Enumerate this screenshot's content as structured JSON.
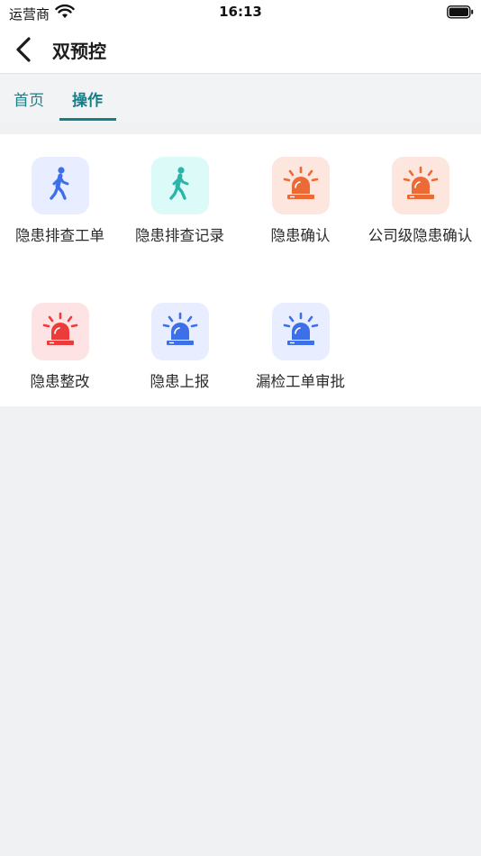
{
  "status_bar": {
    "carrier": "运营商",
    "time": "16:13"
  },
  "nav": {
    "title": "双预控"
  },
  "tabs": [
    {
      "label": "首页",
      "active": false
    },
    {
      "label": "操作",
      "active": true
    }
  ],
  "colors": {
    "accent": "#137d88",
    "walker_blue": "#3d6fe8",
    "walker_teal": "#2bb5a8",
    "alarm_orange": "#ec6a36",
    "alarm_red": "#ec3b3b",
    "alarm_blue": "#3d6fe8"
  },
  "grid": [
    {
      "label": "隐患排查工单",
      "icon": "walking-person-icon",
      "icon_color": "#3d6fe8",
      "bg": "#e8eeff"
    },
    {
      "label": "隐患排查记录",
      "icon": "walking-person-icon",
      "icon_color": "#2bb5a8",
      "bg": "#dcfbf8"
    },
    {
      "label": "隐患确认",
      "icon": "alarm-light-icon",
      "icon_color": "#ec6a36",
      "bg": "#fde6dd"
    },
    {
      "label": "公司级隐患确认",
      "icon": "alarm-light-icon",
      "icon_color": "#ec6a36",
      "bg": "#fde6dd"
    },
    {
      "label": "隐患整改",
      "icon": "alarm-light-icon",
      "icon_color": "#ec3b3b",
      "bg": "#fde3e3"
    },
    {
      "label": "隐患上报",
      "icon": "alarm-light-icon",
      "icon_color": "#3d6fe8",
      "bg": "#e8eeff"
    },
    {
      "label": "漏检工单审批",
      "icon": "alarm-light-icon",
      "icon_color": "#3d6fe8",
      "bg": "#e8eeff"
    }
  ]
}
